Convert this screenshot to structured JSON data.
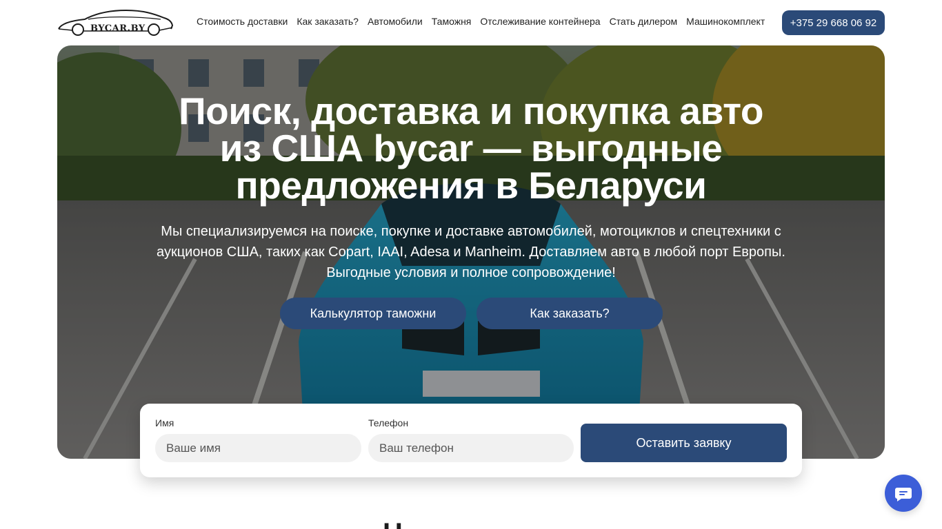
{
  "header": {
    "logo_text": "BYCAR.BY",
    "nav": [
      {
        "label": "Стоимость доставки"
      },
      {
        "label": "Как заказать?"
      },
      {
        "label": "Автомобили"
      },
      {
        "label": "Таможня"
      },
      {
        "label": "Отслеживание контейнера"
      },
      {
        "label": "Стать дилером"
      },
      {
        "label": "Машинокомплект"
      }
    ],
    "phone": "+375 29 668 06 92"
  },
  "hero": {
    "title": "Поиск, доставка и покупка авто из США bycar — выгодные предложения в Беларуси",
    "subtitle": "Мы специализируемся на поиске, покупке и доставке автомобилей, мотоциклов и спецтехники с аукционов США, таких как Copart, IAAI, Adesa и Manheim.  Доставляем авто в любой порт Европы. Выгодные условия и полное сопровождение!",
    "buttons": {
      "calc": "Калькулятор таможни",
      "order": "Как заказать?"
    }
  },
  "form": {
    "name_label": "Имя",
    "name_placeholder": "Ваше имя",
    "phone_label": "Телефон",
    "phone_placeholder": "Ваш телефон",
    "submit": "Оставить заявку"
  },
  "colors": {
    "accent": "#2b4a78",
    "chat": "#3c5ed8",
    "car": "#1fa3c9"
  },
  "icons": {
    "chat": "chat-bubble-icon"
  },
  "section_peek": "Н"
}
